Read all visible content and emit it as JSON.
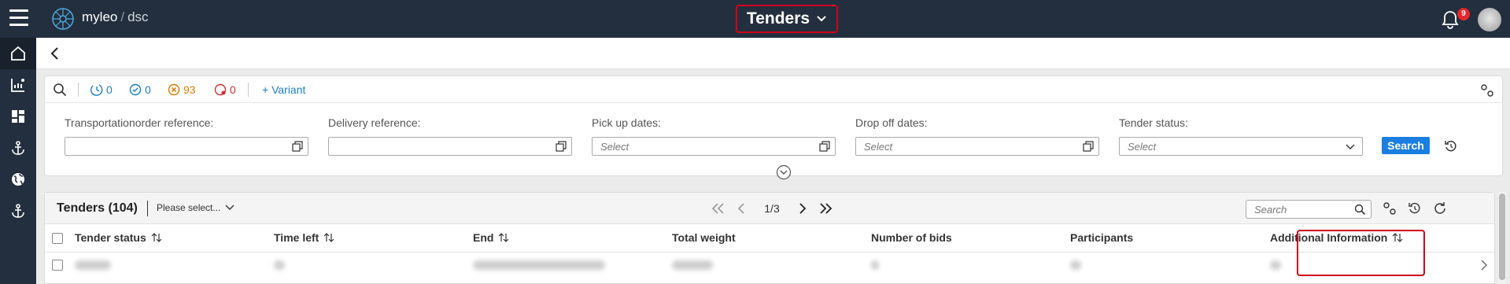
{
  "app": {
    "brand_name": "myleo",
    "brand_separator": "/",
    "brand_sub": "dsc",
    "page_title": "Tenders",
    "notification_count": "9"
  },
  "filter_bar": {
    "counters": [
      {
        "value": "0",
        "color": "#1a7fc8",
        "icon": "clock-icon"
      },
      {
        "value": "0",
        "color": "#1a7fc8",
        "icon": "check-circle-icon"
      },
      {
        "value": "93",
        "color": "#e07b00",
        "icon": "x-circle-icon"
      },
      {
        "value": "0",
        "color": "#d62b2b",
        "icon": "alert-circle-icon"
      }
    ],
    "variant_label": "+ Variant",
    "fields": [
      {
        "label": "Transportationorder reference:",
        "placeholder": ""
      },
      {
        "label": "Delivery reference:",
        "placeholder": ""
      },
      {
        "label": "Pick up dates:",
        "placeholder": "Select"
      },
      {
        "label": "Drop off dates:",
        "placeholder": "Select"
      },
      {
        "label": "Tender status:",
        "placeholder": "Select"
      }
    ],
    "search_label": "Search"
  },
  "table": {
    "title": "Tenders (104)",
    "selector_label": "Please select...",
    "page_indicator": "1/3",
    "search_placeholder": "Search",
    "columns": [
      "Tender status",
      "Time left",
      "End",
      "Total weight",
      "Number of bids",
      "Participants",
      "Additional Information"
    ]
  },
  "colors": {
    "topbar": "#232f3e",
    "accent": "#1a7fe0",
    "highlight": "#d0011b"
  }
}
